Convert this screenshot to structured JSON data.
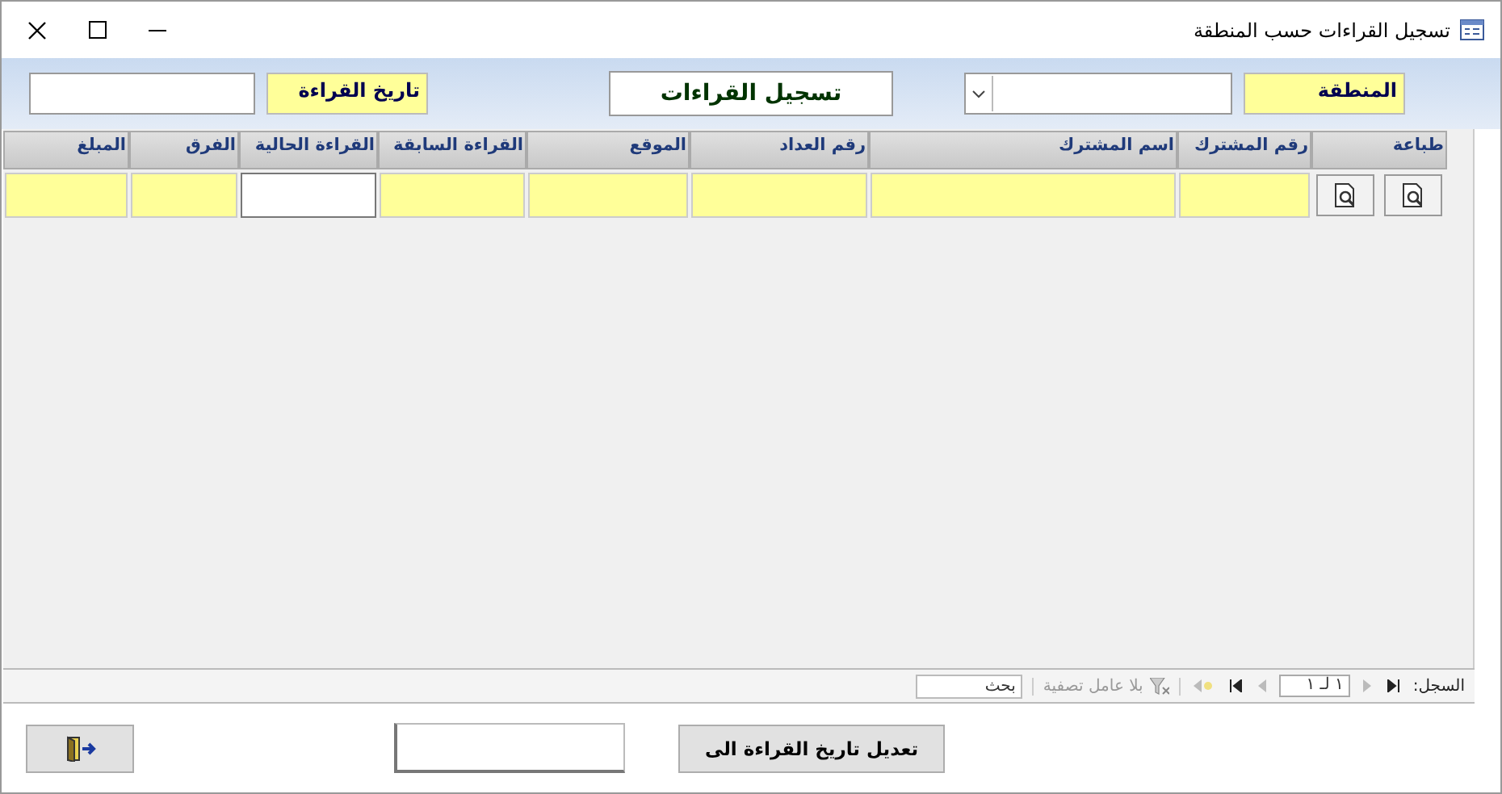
{
  "window": {
    "title": "تسجيل القراءات حسب المنطقة"
  },
  "header": {
    "region_label": "المنطقة",
    "form_title": "تسجيل القراءات",
    "date_label": "تاريخ القراءة"
  },
  "table": {
    "columns": [
      {
        "label": "طباعة",
        "kind": "print"
      },
      {
        "label": "رقم المشترك",
        "kind": "locked"
      },
      {
        "label": "اسم المشترك",
        "kind": "locked"
      },
      {
        "label": "رقم العداد",
        "kind": "locked"
      },
      {
        "label": "الموقع",
        "kind": "locked"
      },
      {
        "label": "القراءة السابقة",
        "kind": "locked"
      },
      {
        "label": "القراءة الحالية",
        "kind": "editable"
      },
      {
        "label": "الفرق",
        "kind": "locked"
      },
      {
        "label": "المبلغ",
        "kind": "locked"
      }
    ]
  },
  "navigation": {
    "label": "السجل:",
    "position": "١ لـ ١",
    "filter": "بلا عامل تصفية",
    "search": "بحث"
  },
  "buttons": {
    "change_date": "تعديل تاريخ القراءة الى"
  }
}
